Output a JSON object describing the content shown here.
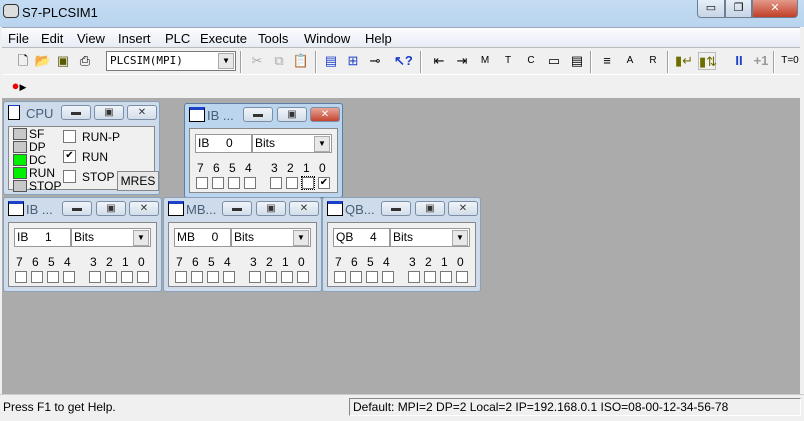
{
  "app": {
    "title": "S7-PLCSIM1",
    "minimize": "▭",
    "restore": "❐",
    "close": "✕"
  },
  "menu": [
    "File",
    "Edit",
    "View",
    "Insert",
    "PLC",
    "Execute",
    "Tools",
    "Window",
    "Help"
  ],
  "toolbar": {
    "connection": "PLCSIM(MPI)",
    "pause": "II",
    "step": "+1",
    "time": "T=0"
  },
  "cpu": {
    "title": "CPU",
    "leds": [
      {
        "label": "SF",
        "on": false
      },
      {
        "label": "DP",
        "on": false
      },
      {
        "label": "DC",
        "on": true
      },
      {
        "label": "RUN",
        "on": true
      },
      {
        "label": "STOP",
        "on": false
      }
    ],
    "modes": [
      {
        "label": "RUN-P",
        "checked": false
      },
      {
        "label": "RUN",
        "checked": true
      },
      {
        "label": "STOP",
        "checked": false
      }
    ],
    "mres": "MRES"
  },
  "windows": [
    {
      "title": "IB ...",
      "address": "IB     0",
      "format": "Bits",
      "bits": [
        false,
        false,
        false,
        false,
        false,
        false,
        false,
        true
      ],
      "active": true
    },
    {
      "title": "IB ...",
      "address": "IB     1",
      "format": "Bits",
      "bits": [
        false,
        false,
        false,
        false,
        false,
        false,
        false,
        false
      ]
    },
    {
      "title": "MB...",
      "address": "MB     0",
      "format": "Bits",
      "bits": [
        false,
        false,
        false,
        false,
        false,
        false,
        false,
        false
      ]
    },
    {
      "title": "QB...",
      "address": "QB     4",
      "format": "Bits",
      "bits": [
        false,
        false,
        false,
        false,
        false,
        false,
        false,
        false
      ]
    }
  ],
  "bit_labels": [
    "7",
    "6",
    "5",
    "4",
    "3",
    "2",
    "1",
    "0"
  ],
  "status": {
    "help": "Press F1 to get Help.",
    "info": "Default:  MPI=2 DP=2 Local=2 IP=192.168.0.1 ISO=08-00-12-34-56-78"
  }
}
